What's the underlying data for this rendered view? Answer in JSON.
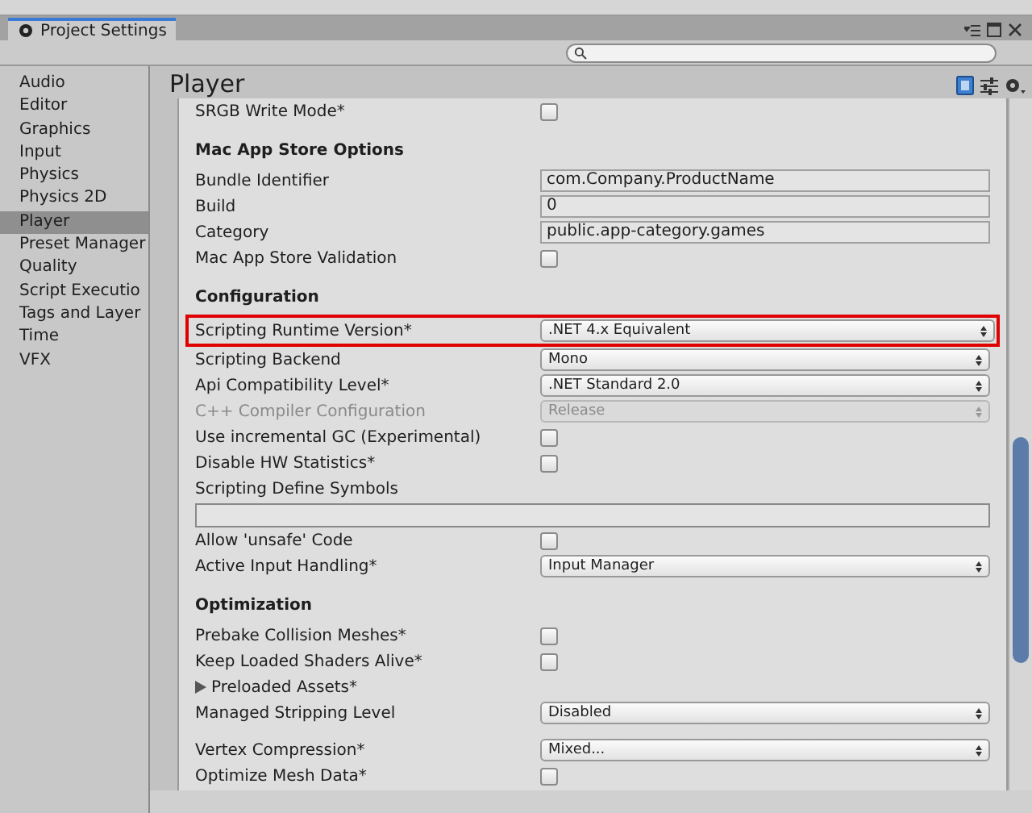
{
  "window": {
    "tab_title": "Project Settings"
  },
  "sidebar": {
    "items": [
      {
        "label": "Audio",
        "selected": false
      },
      {
        "label": "Editor",
        "selected": false
      },
      {
        "label": "Graphics",
        "selected": false
      },
      {
        "label": "Input",
        "selected": false
      },
      {
        "label": "Physics",
        "selected": false
      },
      {
        "label": "Physics 2D",
        "selected": false
      },
      {
        "label": "Player",
        "selected": true
      },
      {
        "label": "Preset Manager",
        "selected": false
      },
      {
        "label": "Quality",
        "selected": false
      },
      {
        "label": "Script Executio",
        "selected": false
      },
      {
        "label": "Tags and Layer",
        "selected": false
      },
      {
        "label": "Time",
        "selected": false
      },
      {
        "label": "VFX",
        "selected": false
      }
    ]
  },
  "panel": {
    "title": "Player"
  },
  "rows": [
    {
      "kind": "checkbox",
      "label": "SRGB Write Mode*",
      "checked": false
    },
    {
      "kind": "header",
      "label": "Mac App Store Options"
    },
    {
      "kind": "text",
      "label": "Bundle Identifier",
      "value": "com.Company.ProductName"
    },
    {
      "kind": "text",
      "label": "Build",
      "value": "0"
    },
    {
      "kind": "text",
      "label": "Category",
      "value": "public.app-category.games"
    },
    {
      "kind": "checkbox",
      "label": "Mac App Store Validation",
      "checked": false
    },
    {
      "kind": "header",
      "label": "Configuration"
    },
    {
      "kind": "dropdown",
      "label": "Scripting Runtime Version*",
      "value": ".NET 4.x Equivalent",
      "highlighted": true,
      "disabled": false
    },
    {
      "kind": "dropdown",
      "label": "Scripting Backend",
      "value": "Mono",
      "highlighted": false,
      "disabled": false
    },
    {
      "kind": "dropdown",
      "label": "Api Compatibility Level*",
      "value": ".NET Standard 2.0",
      "highlighted": false,
      "disabled": false
    },
    {
      "kind": "dropdown",
      "label": "C++ Compiler Configuration",
      "value": "Release",
      "highlighted": false,
      "disabled": true
    },
    {
      "kind": "checkbox",
      "label": "Use incremental GC (Experimental)",
      "checked": false
    },
    {
      "kind": "checkbox",
      "label": "Disable HW Statistics*",
      "checked": false
    },
    {
      "kind": "wide_text",
      "label": "Scripting Define Symbols"
    },
    {
      "kind": "checkbox",
      "label": "Allow 'unsafe' Code",
      "checked": false
    },
    {
      "kind": "dropdown",
      "label": "Active Input Handling*",
      "value": "Input Manager",
      "highlighted": false,
      "disabled": false
    },
    {
      "kind": "header",
      "label": "Optimization"
    },
    {
      "kind": "checkbox",
      "label": "Prebake Collision Meshes*",
      "checked": false
    },
    {
      "kind": "checkbox",
      "label": "Keep Loaded Shaders Alive*",
      "checked": false
    },
    {
      "kind": "foldout",
      "label": "Preloaded Assets*",
      "expanded": false
    },
    {
      "kind": "dropdown",
      "label": "Managed Stripping Level",
      "value": "Disabled",
      "highlighted": false,
      "disabled": false
    },
    {
      "kind": "spacer"
    },
    {
      "kind": "dropdown",
      "label": "Vertex Compression*",
      "value": "Mixed...",
      "highlighted": false,
      "disabled": false
    },
    {
      "kind": "checkbox",
      "label": "Optimize Mesh Data*",
      "checked": false
    }
  ]
}
